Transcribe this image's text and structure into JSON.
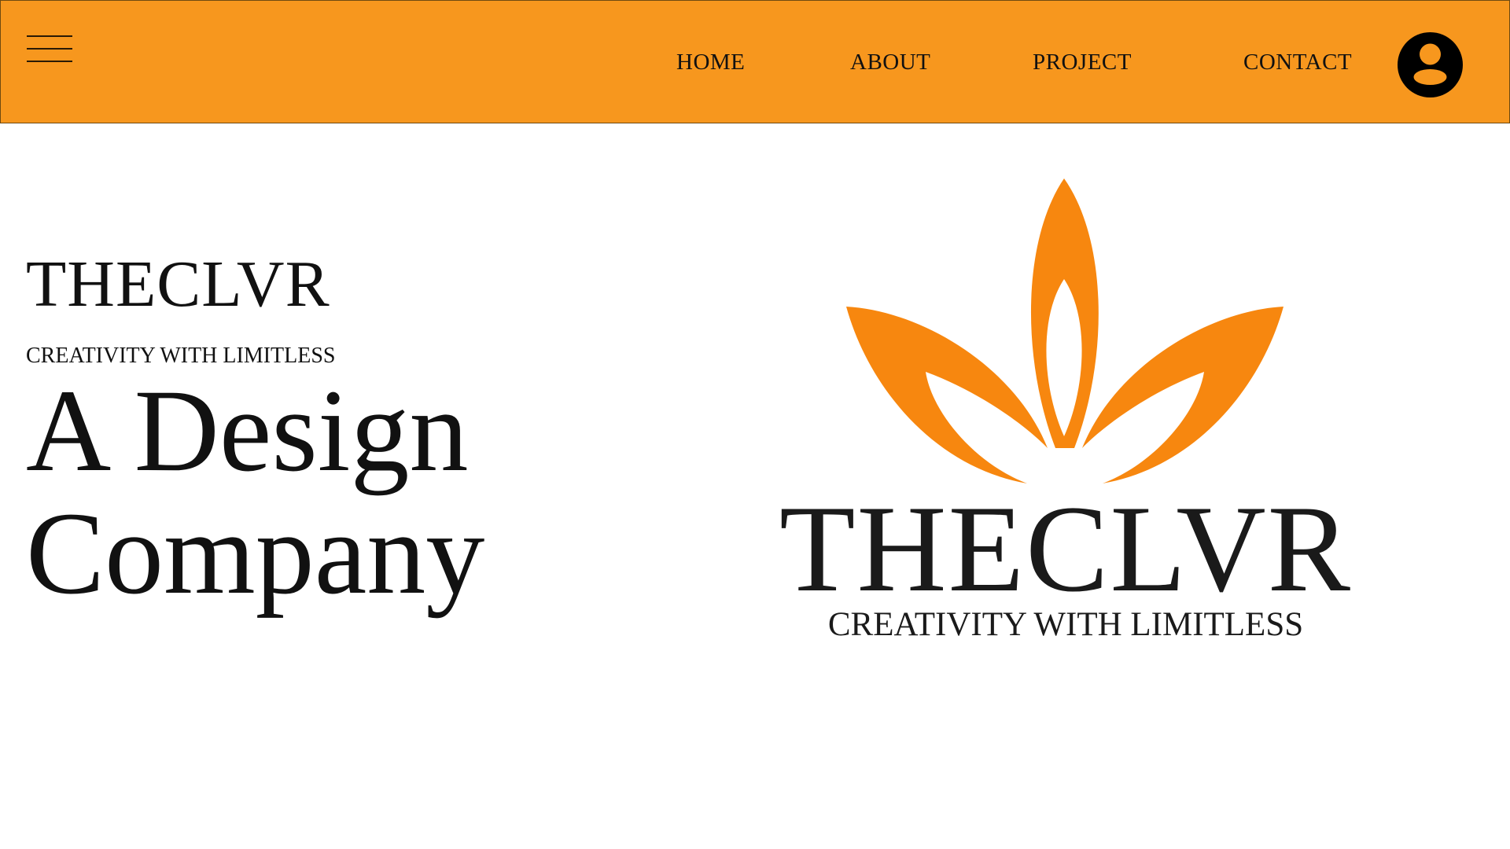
{
  "header": {
    "menu_icon": "hamburger-menu-icon",
    "nav": [
      {
        "label": "HOME"
      },
      {
        "label": "ABOUT"
      },
      {
        "label": "PROJECT"
      },
      {
        "label": "CONTACT"
      }
    ],
    "profile_icon": "user-profile-icon"
  },
  "hero": {
    "brand": "THECLVR",
    "tagline": "CREATIVITY WITH LIMITLESS",
    "heading_line1": "A Design",
    "heading_line2": "Company"
  },
  "logo": {
    "icon": "lotus-leaf-logo-icon",
    "wordmark": "THECLVR",
    "tagline": "CREATIVITY WITH LIMITLESS"
  },
  "colors": {
    "header_bg": "#F7971E",
    "logo_orange": "#F7870F",
    "text": "#111111"
  }
}
